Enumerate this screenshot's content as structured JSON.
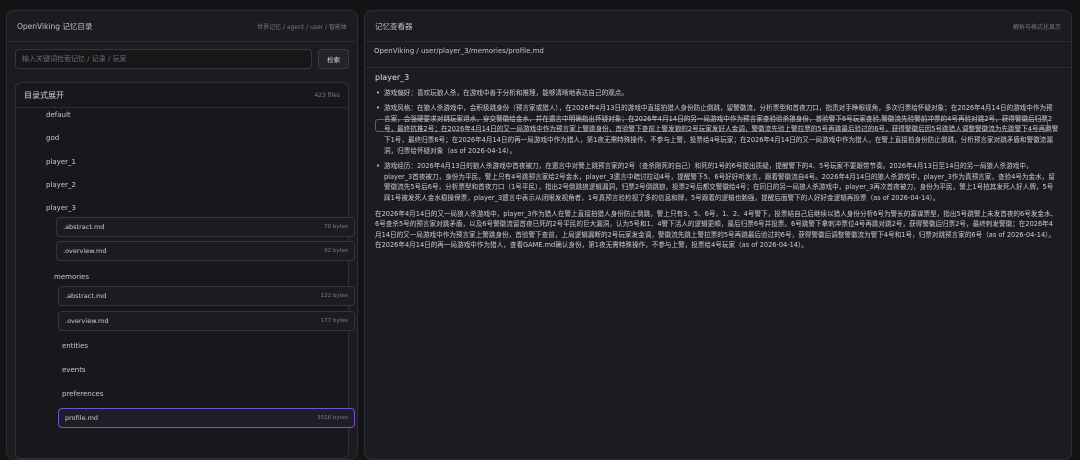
{
  "left_panel": {
    "title": "OpenViking 记忆目录",
    "breadcrumb": "世界记忆 / agent / user / 智能体",
    "search": {
      "placeholder": "输入关键词检索记忆 / 记录 / 玩家",
      "button": "检索"
    },
    "tree": {
      "header": "目录式展开",
      "count": "423 files",
      "nodes": [
        "default",
        "god",
        "player_1",
        "player_2",
        "player_3"
      ],
      "p3_files": [
        {
          "name": ".abstract.md",
          "size": "70 bytes"
        },
        {
          "name": ".overview.md",
          "size": "92 bytes"
        }
      ],
      "memories_label": "memories",
      "mem_files": [
        {
          "name": ".abstract.md",
          "size": "122 bytes"
        },
        {
          "name": ".overview.md",
          "size": "177 bytes"
        }
      ],
      "mem_dirs": [
        "entities",
        "events",
        "preferences"
      ],
      "selected": {
        "name": "profile.md",
        "size": "3516 bytes"
      }
    }
  },
  "right_panel": {
    "title": "记忆查看器",
    "action": "解析与格式化显示",
    "path": "OpenViking / user/player_3/memories/profile.md",
    "doc_title": "player_3",
    "bullets": [
      "游戏偏好：喜欢玩狼人杀，在游戏中善于分析和推理，能够清晰地表达自己的观点。",
      "游戏风格：在狼人杀游戏中，会积极跳身份（预言家或猎人），在2026年4月13日的游戏中直接拍猎人身份防止倒跳，留警徽流，分析票型和首夜刀口，指责对手睁眼视角，多次归票给怀疑对象；在2026年4月14日的游戏中作为预言家，会强硬要求对跳玩家退水，穿交警徽给金水，并在遗言中明确指出怀疑对象；在2026年4月14日的另一局游戏中作为预言家查验验杀狼身份，首验警下6号玩家查验,警徽流先验警前冲票的4号再验对跳2号，获得警徽后归票2号，最终抗推2号；在2026年4月14日的又一局游戏中作为预言家上警跳身份，首验警下查前上警发狼的2号玩家发好人金调，警徽流先验上警拉票的5号再跳最后验过的6号，获得警徽后因5号跳猎人调整警徽流为先跳警下4号再跳警下1号，最终归票6号；在2026年4月14日的再一局游戏中作为猎人，第1夜无需特殊操作，不参与上警，投票给4号玩家；在2026年4月14日的又一局游戏中作为猎人，在警上直接拍身份防止倒跳，分析预言家对跳矛盾和警徽流漏洞，归票给怀疑对象（as of 2026-04-14）。",
      "游戏经历：2026年4月13日的狼人杀游戏中首夜被刀，在遗言中对警上跳预言家的2号（查杀刚死的自己）和死的1号的6号提出质疑，提醒警下的4、5号玩家不要跟带节奏。2026年4月13日至14日的另一局狼人杀游戏中，player_3首夜被刀，身份为平民，警上只有4号跳预言家给2号金水，player_3遗言中暗讨拉动4号，提醒警下5、6号好好听发言，跟着警徽流自4号。2026年4月14日的狼人杀游戏中，player_3作为真预言家，查验4号为金水，留警徽流先5号后6号，分析票型和首夜刀口（1号平民），指出2号倒跳狼逻辑漏洞，归票2号倒跳狼，投票2号后都交警徽给4号；在同日的另一局狼人杀游戏中，player_3再次首夜被刀，身份为平民，警上1号拍其发死人好人牌，5号踩1号被发死人金水稳操保票，player_3遗言中表示从闭眼发视角者，1号真预言验检视了多的信息和牌，5号跟着的逻辑也勉强，提醒后面警下的人好好金逻辑再投票（as of 2026-04-14）。"
    ],
    "paragraphs": [
      "在2026年4月14日的又一局狼人杀游戏中，player_3作为猎人在警上直接拍猎人身份防止倒跳，警上只有3、5、6号，1、2、4号警下，投票结自己后继续以猎人身份分析6号为警长的寡谋票型，指出5号跳警上未发首夜的6号发金水、6号查杀5号的预言家对跳矛盾，以及6号警徽流留首夜已死的2号平民的巨大漏洞，认为5号和1、4警下活人的逻辑更顺，最后归票6号并投票。6号跳警下拿刺冲票位4号再跳对跳2号，获得警徽后归票2号，最终刺发警徽；在2026年4月14日的又一局游戏中作为预言家上警跳身份，首验警下查前，上局逻辑漏断的2号玩家发金调，警徽流先跳上警拉票的5号再跳最后验过的6号，获得警徽后调整警徽流为警下4号和1号，归票对跳预言家的6号（as of 2026-04-14）。",
      "在2026年4月14日的再一局游戏中作为猎人，查看GAME.md确认身份，第1夜无需特殊操作，不参与上警，投票给4号玩家（as of 2026-04-14）。"
    ]
  }
}
